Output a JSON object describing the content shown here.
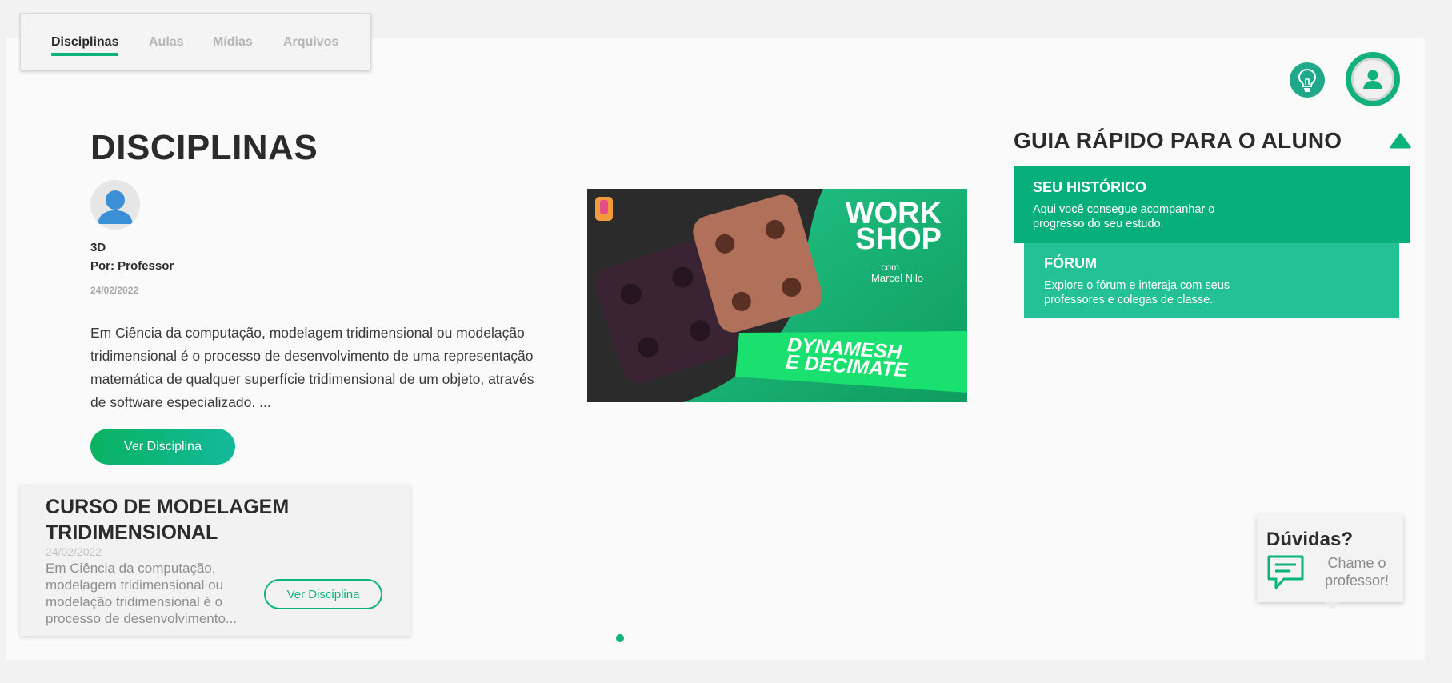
{
  "tabs": [
    {
      "label": "Disciplinas",
      "active": true
    },
    {
      "label": "Aulas",
      "active": false
    },
    {
      "label": "Mídias",
      "active": false
    },
    {
      "label": "Arquivos",
      "active": false
    }
  ],
  "header": {
    "bulb_icon": "lightbulb-icon",
    "profile_icon": "user-profile-icon",
    "accent_color": "#0ab37a"
  },
  "main": {
    "title": "DISCIPLINAS",
    "subject": "3D",
    "author": "Por: Professor",
    "date": "24/02/2022",
    "description": "Em Ciência da computação, modelagem tridimensional ou modelação tridimensional é o processo de desenvolvimento de uma representação matemática de qualquer superfície tridimensional de um objeto, através de software especializado. ...",
    "button_label": "Ver Disciplina"
  },
  "banner": {
    "line1": "WORK",
    "line2": "SHOP",
    "by1": "com",
    "by2": "Marcel Nilo",
    "tag1": "DYNAMESH",
    "tag2": "E DECIMATE"
  },
  "guide": {
    "title": "GUIA RÁPIDO PARA O ALUNO",
    "cards": [
      {
        "title": "SEU HISTÓRICO",
        "description": "Aqui você consegue acompanhar o progresso do seu estudo."
      },
      {
        "title": "FÓRUM",
        "description": "Explore o fórum e interaja com seus professores e colegas de classe."
      }
    ]
  },
  "course_card": {
    "title": "CURSO DE MODELAGEM TRIDIMENSIONAL",
    "date": "24/02/2022",
    "description": "Em Ciência da computação, modelagem tridimensional ou modelação tridimensional é o processo de desenvolvimento...",
    "button_label": "Ver Disciplina"
  },
  "help": {
    "title": "Dúvidas?",
    "subtitle": "Chame o professor!",
    "icon": "chat-icon"
  }
}
